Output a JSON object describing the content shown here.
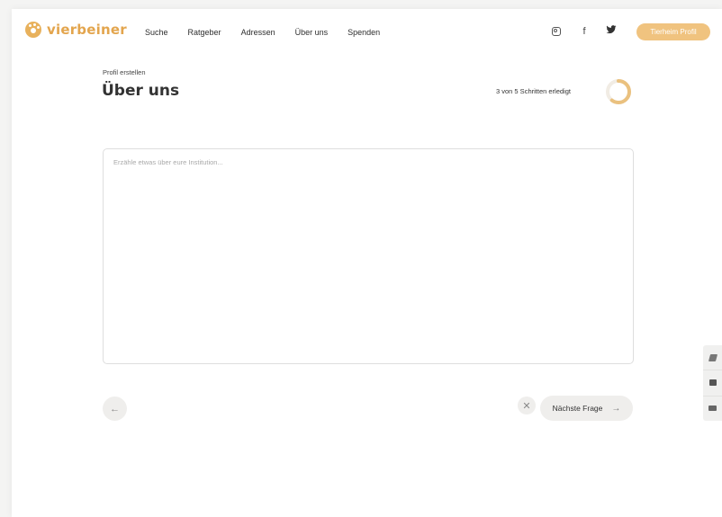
{
  "brand": {
    "name": "vierbeiner",
    "accent": "#e3a54d"
  },
  "nav": {
    "items": [
      "Suche",
      "Ratgeber",
      "Adressen",
      "Über uns",
      "Spenden"
    ]
  },
  "social": {
    "icons": [
      "instagram-icon",
      "facebook-icon",
      "twitter-icon"
    ],
    "facebook_glyph": "f"
  },
  "header": {
    "profile_button": "Tierheim Profil"
  },
  "page": {
    "breadcrumb": "Profil erstellen",
    "title": "Über uns",
    "progress_text": "3 von 5 Schritten erledigt",
    "progress_fraction": 0.6
  },
  "form": {
    "placeholder": "Erzähle etwas über eure Institution...",
    "value": ""
  },
  "footer": {
    "next_label": "Nächste Frage",
    "back_icon": "←",
    "close_icon": "✕",
    "next_icon": "→"
  },
  "colors": {
    "progress_fill": "#eac17f",
    "progress_track": "#f1ece4",
    "button_bg": "#efeeec"
  }
}
